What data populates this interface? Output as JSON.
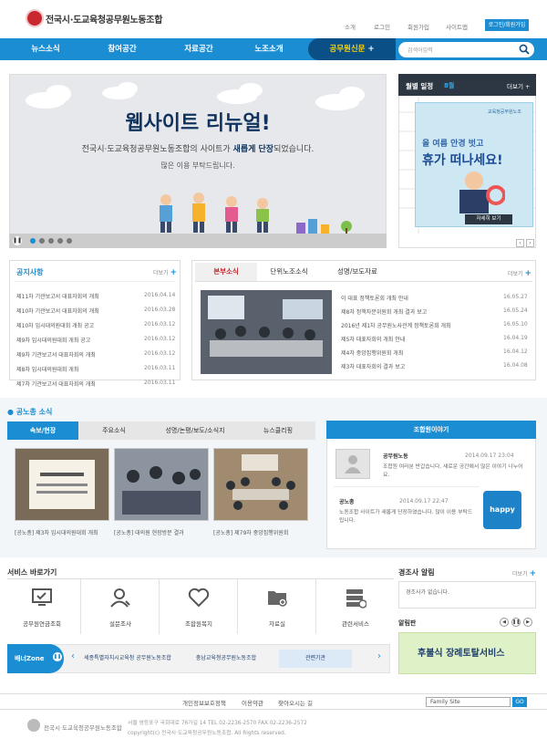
{
  "header": {
    "site_title": "전국시·도교육청공무원노동조합",
    "top_links": [
      "소개",
      "로그인",
      "회원가입",
      "사이트맵"
    ],
    "login_button": "로그인/회원가입"
  },
  "nav": {
    "items": [
      "뉴스소식",
      "참여공간",
      "자료공간",
      "노조소개"
    ],
    "special": "공무원신문",
    "search_placeholder": "검색어입력"
  },
  "banner": {
    "title": "웹사이트 리뉴얼!",
    "line1_pre": "전국시·도교육청공무원노동조합의 사이트가 ",
    "line1_bold": "새롭게 단장",
    "line1_post": "되었습니다.",
    "line2": "많은 이용 부탁드립니다."
  },
  "calendar": {
    "title": "월별 일정",
    "month": "8월",
    "more": "더보기"
  },
  "popup": {
    "org": "교육청공무원노조",
    "line1": "올 여름 안경 벗고",
    "line2": "휴가 떠나세요!",
    "button": "자세히 보기"
  },
  "notice": {
    "title": "공지사항",
    "more": "더보기",
    "rows": [
      {
        "text": "제11차 기관보고서 대표자회의 개최",
        "date": "2016.04.14"
      },
      {
        "text": "제10차 기관보고서 대표자회의 개최",
        "date": "2016.03.28"
      },
      {
        "text": "제10차 임시대의원대회 개최 공고",
        "date": "2016.03.12"
      },
      {
        "text": "제9차 임시대의원대회 개최 공고",
        "date": "2016.03.12"
      },
      {
        "text": "제9차 기관보고서 대표자회의 개최",
        "date": "2016.03.12"
      },
      {
        "text": "제8차 임시대의원대회 개최",
        "date": "2016.03.11"
      },
      {
        "text": "제7차 기관보고서 대표자회의 개최",
        "date": "2016.03.11"
      }
    ]
  },
  "news": {
    "tabs": [
      "본부소식",
      "단위노조소식",
      "성명/보도자료"
    ],
    "more": "더보기",
    "rows": [
      {
        "text": "이 대표 정책토론회 개최 안내",
        "date": "16.05.27"
      },
      {
        "text": "제8차 정책자문위원회 개최 결과 보고",
        "date": "16.05.24"
      },
      {
        "text": "2016년 제1차 공무원노사관계 정책토론회 개최",
        "date": "16.05.10"
      },
      {
        "text": "제5차 대표자회의 개최 안내",
        "date": "16.04.19"
      },
      {
        "text": "제4차 중앙집행위원회 개최",
        "date": "16.04.12"
      },
      {
        "text": "제3차 대표자회의 결과 보고",
        "date": "16.04.08"
      }
    ]
  },
  "union": {
    "title": "공노총 소식",
    "tabs": [
      "속보/현장",
      "주요소식",
      "성명/논평/보도/소식지",
      "뉴스클리핑"
    ],
    "captions": [
      "[공노총] 제3차 임시대의원대회 개최",
      "[공노총] 대의원 현장방문 결과",
      "[공노총] 제79차 중앙집행위원회"
    ]
  },
  "talk": {
    "title": "조합원이야기",
    "items": [
      {
        "name": "공무원노동",
        "date": "2014.09.17 23:04",
        "text": "조합원 여러분 반갑습니다. 새로운 공간에서 많은 이야기 나누어요."
      },
      {
        "name": "공노총",
        "date": "2014.09.17 22:47",
        "text": "노동조합 사이트가 새롭게 단장하였습니다. 많이 이용 부탁드립니다."
      }
    ],
    "badge": "happy"
  },
  "services": {
    "title": "서비스 바로가기",
    "items": [
      {
        "label": "공무원연금조회",
        "icon": "monitor-icon"
      },
      {
        "label": "설문조사",
        "icon": "user-icon"
      },
      {
        "label": "조합원복지",
        "icon": "heart-icon"
      },
      {
        "label": "자료실",
        "icon": "folder-icon"
      },
      {
        "label": "관련서비스",
        "icon": "server-icon"
      }
    ]
  },
  "board": {
    "title": "경조사 알림",
    "more": "더보기",
    "empty": "경조사가 없습니다."
  },
  "alim": {
    "title": "알림판",
    "text": "후불식 장례토탈서비스"
  },
  "banner_zone": {
    "label": "배너Zone",
    "items": [
      "세종특별자치시교육청 공무원노동조합",
      "충남교육청공무원노동조합",
      "관련기관"
    ]
  },
  "footer": {
    "links": [
      "개인정보보호정책",
      "이용약관",
      "찾아오시는 길"
    ],
    "family_site": "Family Site",
    "go": "GO",
    "org_name": "전국시·도교육청공무원노동조합",
    "address": "서울 영등포구 국회대로 76가길 14  TEL 02-2236-2570  FAX 02-2236-2572",
    "copyright": "copyright(c) 전국시·도교육청공무원노동조합. All Rights reserved."
  },
  "colors": {
    "primary": "#1b8dd3",
    "dark": "#0a4f86",
    "accent": "#ffd400",
    "brand_red": "#c8282e"
  }
}
